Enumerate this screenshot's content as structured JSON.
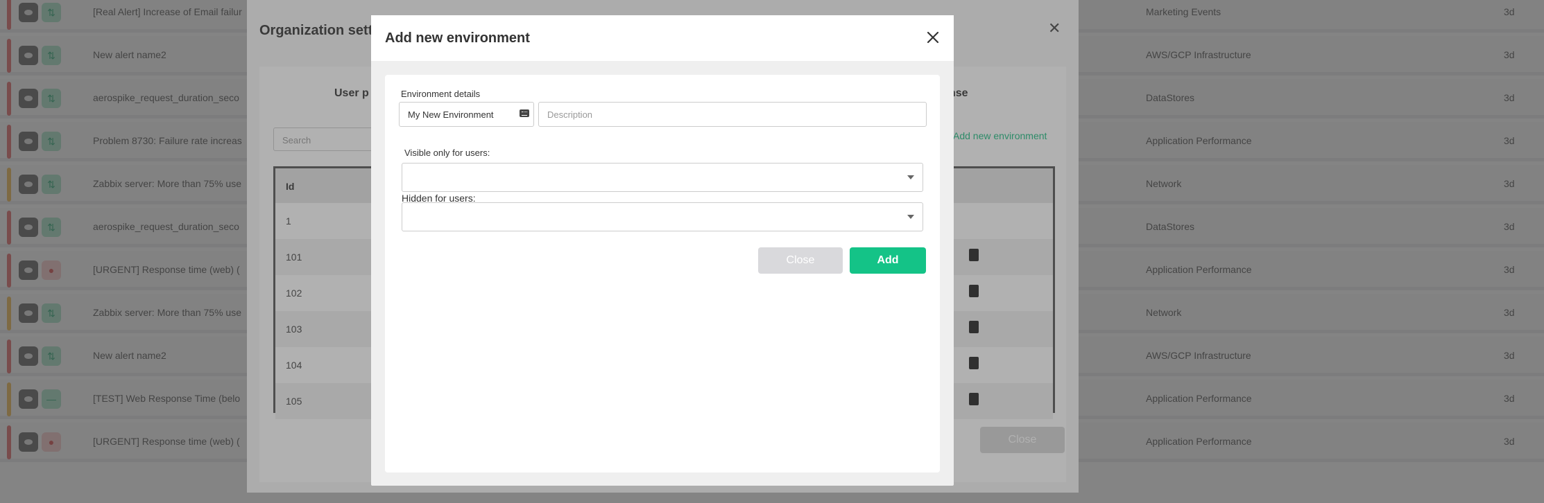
{
  "background_alerts": [
    {
      "name": "[Real Alert] Increase of Email failur",
      "category": "Marketing Events",
      "age": "3d",
      "severity_color": "#e05a5a",
      "status_icon": "refresh-icon"
    },
    {
      "name": "New alert name2",
      "category": "AWS/GCP Infrastructure",
      "age": "3d",
      "severity_color": "#e05a5a",
      "status_icon": "refresh-icon"
    },
    {
      "name": "aerospike_request_duration_seco",
      "category": "DataStores",
      "age": "3d",
      "severity_color": "#e05a5a",
      "status_icon": "refresh-icon"
    },
    {
      "name": "Problem 8730: Failure rate increas",
      "category": "Application Performance",
      "age": "3d",
      "severity_color": "#e05a5a",
      "status_icon": "refresh-icon"
    },
    {
      "name": "Zabbix server: More than 75% use",
      "category": "Network",
      "age": "3d",
      "severity_color": "#f0b440",
      "status_icon": "refresh-icon"
    },
    {
      "name": "aerospike_request_duration_seco",
      "category": "DataStores",
      "age": "3d",
      "severity_color": "#e05a5a",
      "status_icon": "refresh-icon"
    },
    {
      "name": "[URGENT] Response time (web) (",
      "category": "Application Performance",
      "age": "3d",
      "severity_color": "#e05a5a",
      "status_icon": "urgent-icon"
    },
    {
      "name": "Zabbix server: More than 75% use",
      "category": "Network",
      "age": "3d",
      "severity_color": "#f0b440",
      "status_icon": "refresh-icon"
    },
    {
      "name": "New alert name2",
      "category": "AWS/GCP Infrastructure",
      "age": "3d",
      "severity_color": "#e05a5a",
      "status_icon": "refresh-icon"
    },
    {
      "name": "[TEST] Web Response Time (belo",
      "category": "Application Performance",
      "age": "3d",
      "severity_color": "#f0b440",
      "status_icon": "minus-icon"
    },
    {
      "name": "[URGENT] Response time (web) (",
      "category": "Application Performance",
      "age": "3d",
      "severity_color": "#e05a5a",
      "status_icon": "urgent-icon"
    }
  ],
  "org_settings": {
    "title": "Organization sett",
    "tab_left": "User p",
    "tab_right": "nse",
    "search_placeholder": "Search",
    "add_link": "Add new environment",
    "table_header_id": "Id",
    "rows": [
      "1",
      "101",
      "102",
      "103",
      "104",
      "105"
    ],
    "close_label": "Close"
  },
  "modal": {
    "title": "Add new environment",
    "section_label": "Environment details",
    "env_name_value": "My New Environment",
    "description_placeholder": "Description",
    "visible_label": "Visible only for users:",
    "hidden_label": "Hidden for users:",
    "close_label": "Close",
    "add_label": "Add"
  },
  "colors": {
    "accent": "#14c387",
    "disabled_button": "#d9d9dc"
  }
}
